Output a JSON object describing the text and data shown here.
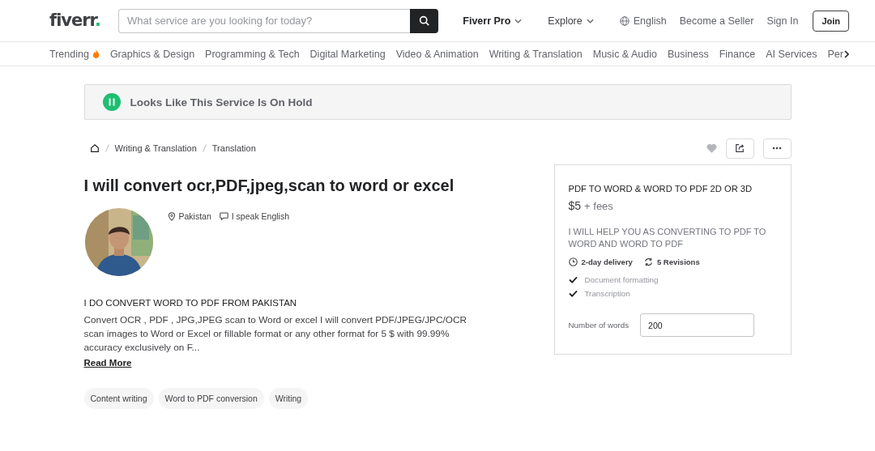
{
  "header": {
    "logo": {
      "text": "fiverr",
      "mark": "."
    },
    "search": {
      "placeholder": "What service are you looking for today?"
    },
    "nav": [
      {
        "label": "Fiverr Pro",
        "kind": "dropdown"
      },
      {
        "label": "Explore",
        "kind": "dropdown"
      },
      {
        "label": "English",
        "kind": "globe"
      },
      {
        "label": "Become a Seller",
        "kind": "link"
      },
      {
        "label": "Sign In",
        "kind": "link"
      },
      {
        "label": "Join",
        "kind": "button"
      }
    ]
  },
  "categories": [
    {
      "label": "Trending",
      "kind": "trending"
    },
    {
      "label": "Graphics & Design",
      "kind": "plain"
    },
    {
      "label": "Programming & Tech",
      "kind": "plain"
    },
    {
      "label": "Digital Marketing",
      "kind": "plain"
    },
    {
      "label": "Video & Animation",
      "kind": "plain"
    },
    {
      "label": "Writing & Translation",
      "kind": "plain"
    },
    {
      "label": "Music & Audio",
      "kind": "plain"
    },
    {
      "label": "Business",
      "kind": "plain"
    },
    {
      "label": "Finance",
      "kind": "plain"
    },
    {
      "label": "AI Services",
      "kind": "plain"
    },
    {
      "label": "Per",
      "kind": "more"
    }
  ],
  "notice": {
    "text": "Looks Like This Service Is On Hold"
  },
  "breadcrumb": [
    "Writing & Translation",
    "Translation"
  ],
  "gig": {
    "title": "I will convert ocr,PDF,jpeg,scan to word or excel",
    "location": "Pakistan",
    "language": "I speak English",
    "about_title": "I DO CONVERT WORD TO PDF FROM PAKISTAN",
    "description": "Convert OCR , PDF , JPG,JPEG scan to Word or excel I will convert PDF/JPEG/JPC/OCR scan images to Word or Excel or fillable format or any other format for 5 $ with 99.99% accuracy exclusively on F...",
    "read_more": "Read More",
    "tags": [
      "Content writing",
      "Word to PDF conversion",
      "Writing"
    ]
  },
  "package": {
    "title": "PDF TO WORD & WORD TO PDF 2D OR 3D",
    "price": "$5",
    "fees": "+ fees",
    "description": "I WILL HELP YOU AS CONVERTING TO PDF TO WORD AND WORD TO PDF",
    "delivery": "2-day delivery",
    "revisions": "5 Revisions",
    "features": [
      {
        "label": "Document formatting",
        "included": true
      },
      {
        "label": "Transcription",
        "included": true
      }
    ],
    "quantity": {
      "label": "Number of words",
      "value": "200"
    }
  }
}
